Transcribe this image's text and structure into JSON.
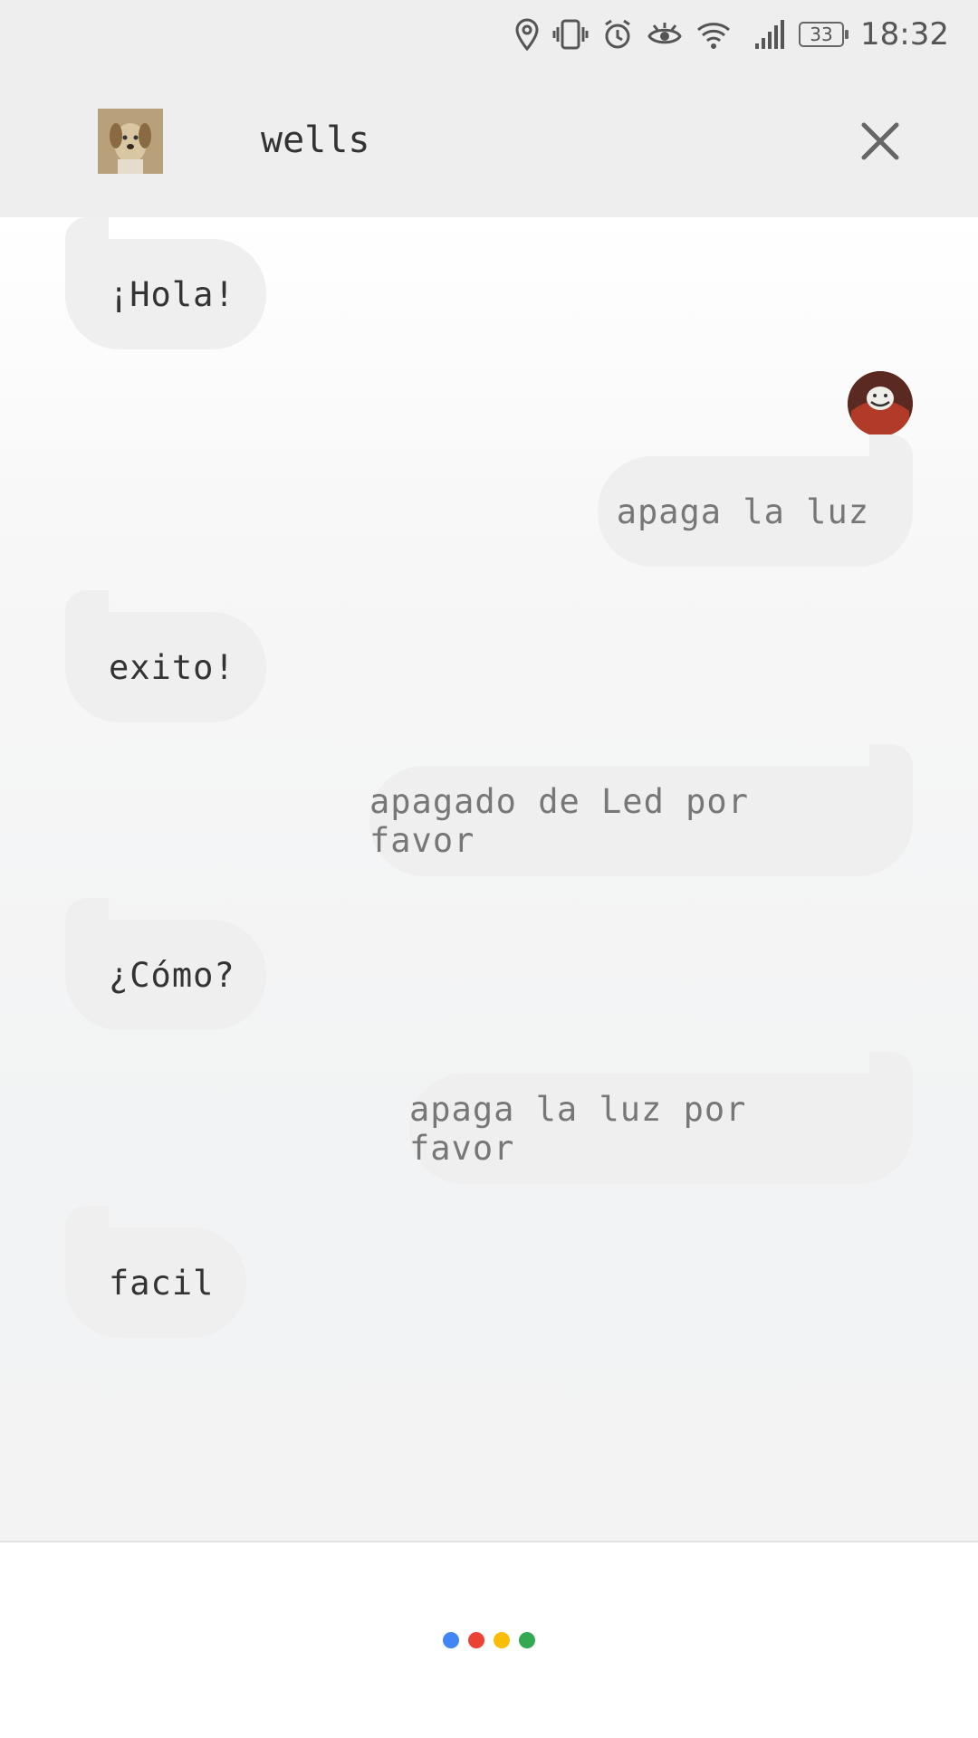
{
  "status_bar": {
    "icons": [
      "location-icon",
      "vibrate-icon",
      "alarm-icon",
      "eye-icon",
      "wifi-icon",
      "signal-icon"
    ],
    "battery": "33",
    "time": "18:32"
  },
  "header": {
    "title": "wells",
    "close_icon": "close-icon"
  },
  "messages": [
    {
      "sender": "agent",
      "text": "¡Hola!"
    },
    {
      "sender": "user",
      "text": "apaga la luz"
    },
    {
      "sender": "agent",
      "text": "exito!"
    },
    {
      "sender": "user",
      "text": "apagado de Led por favor"
    },
    {
      "sender": "agent",
      "text": "¿Cómo?"
    },
    {
      "sender": "user",
      "text": "apaga la luz por favor"
    },
    {
      "sender": "agent",
      "text": "facil"
    }
  ],
  "assistant_dots": {
    "colors": [
      "#4285F4",
      "#EA4335",
      "#FBBC05",
      "#34A853"
    ]
  }
}
